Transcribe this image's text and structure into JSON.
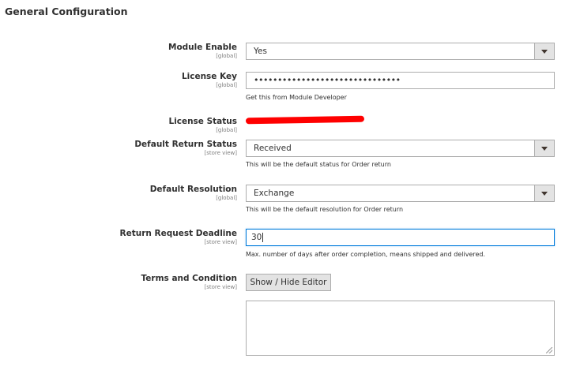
{
  "section": {
    "title": "General Configuration"
  },
  "fields": {
    "module_enable": {
      "label": "Module Enable",
      "scope": "[global]",
      "value": "Yes"
    },
    "license_key": {
      "label": "License Key",
      "scope": "[global]",
      "value": "•••••••••••••••••••••••••••••••",
      "note": "Get this from Module Developer"
    },
    "license_status": {
      "label": "License Status",
      "scope": "[global]"
    },
    "default_return_status": {
      "label": "Default Return Status",
      "scope": "[store view]",
      "value": "Received",
      "note": "This will be the default status for Order return"
    },
    "default_resolution": {
      "label": "Default Resolution",
      "scope": "[global]",
      "value": "Exchange",
      "note": "This will be the default resolution for Order return"
    },
    "return_request_deadline": {
      "label": "Return Request Deadline",
      "scope": "[store view]",
      "value": "30",
      "note": "Max. number of days after order completion, means shipped and delivered."
    },
    "terms_and_condition": {
      "label": "Terms and Condition",
      "scope": "[store view]",
      "button_label": "Show / Hide Editor"
    }
  },
  "colors": {
    "focus_border": "#007bdb",
    "redaction": "#ff0000"
  }
}
